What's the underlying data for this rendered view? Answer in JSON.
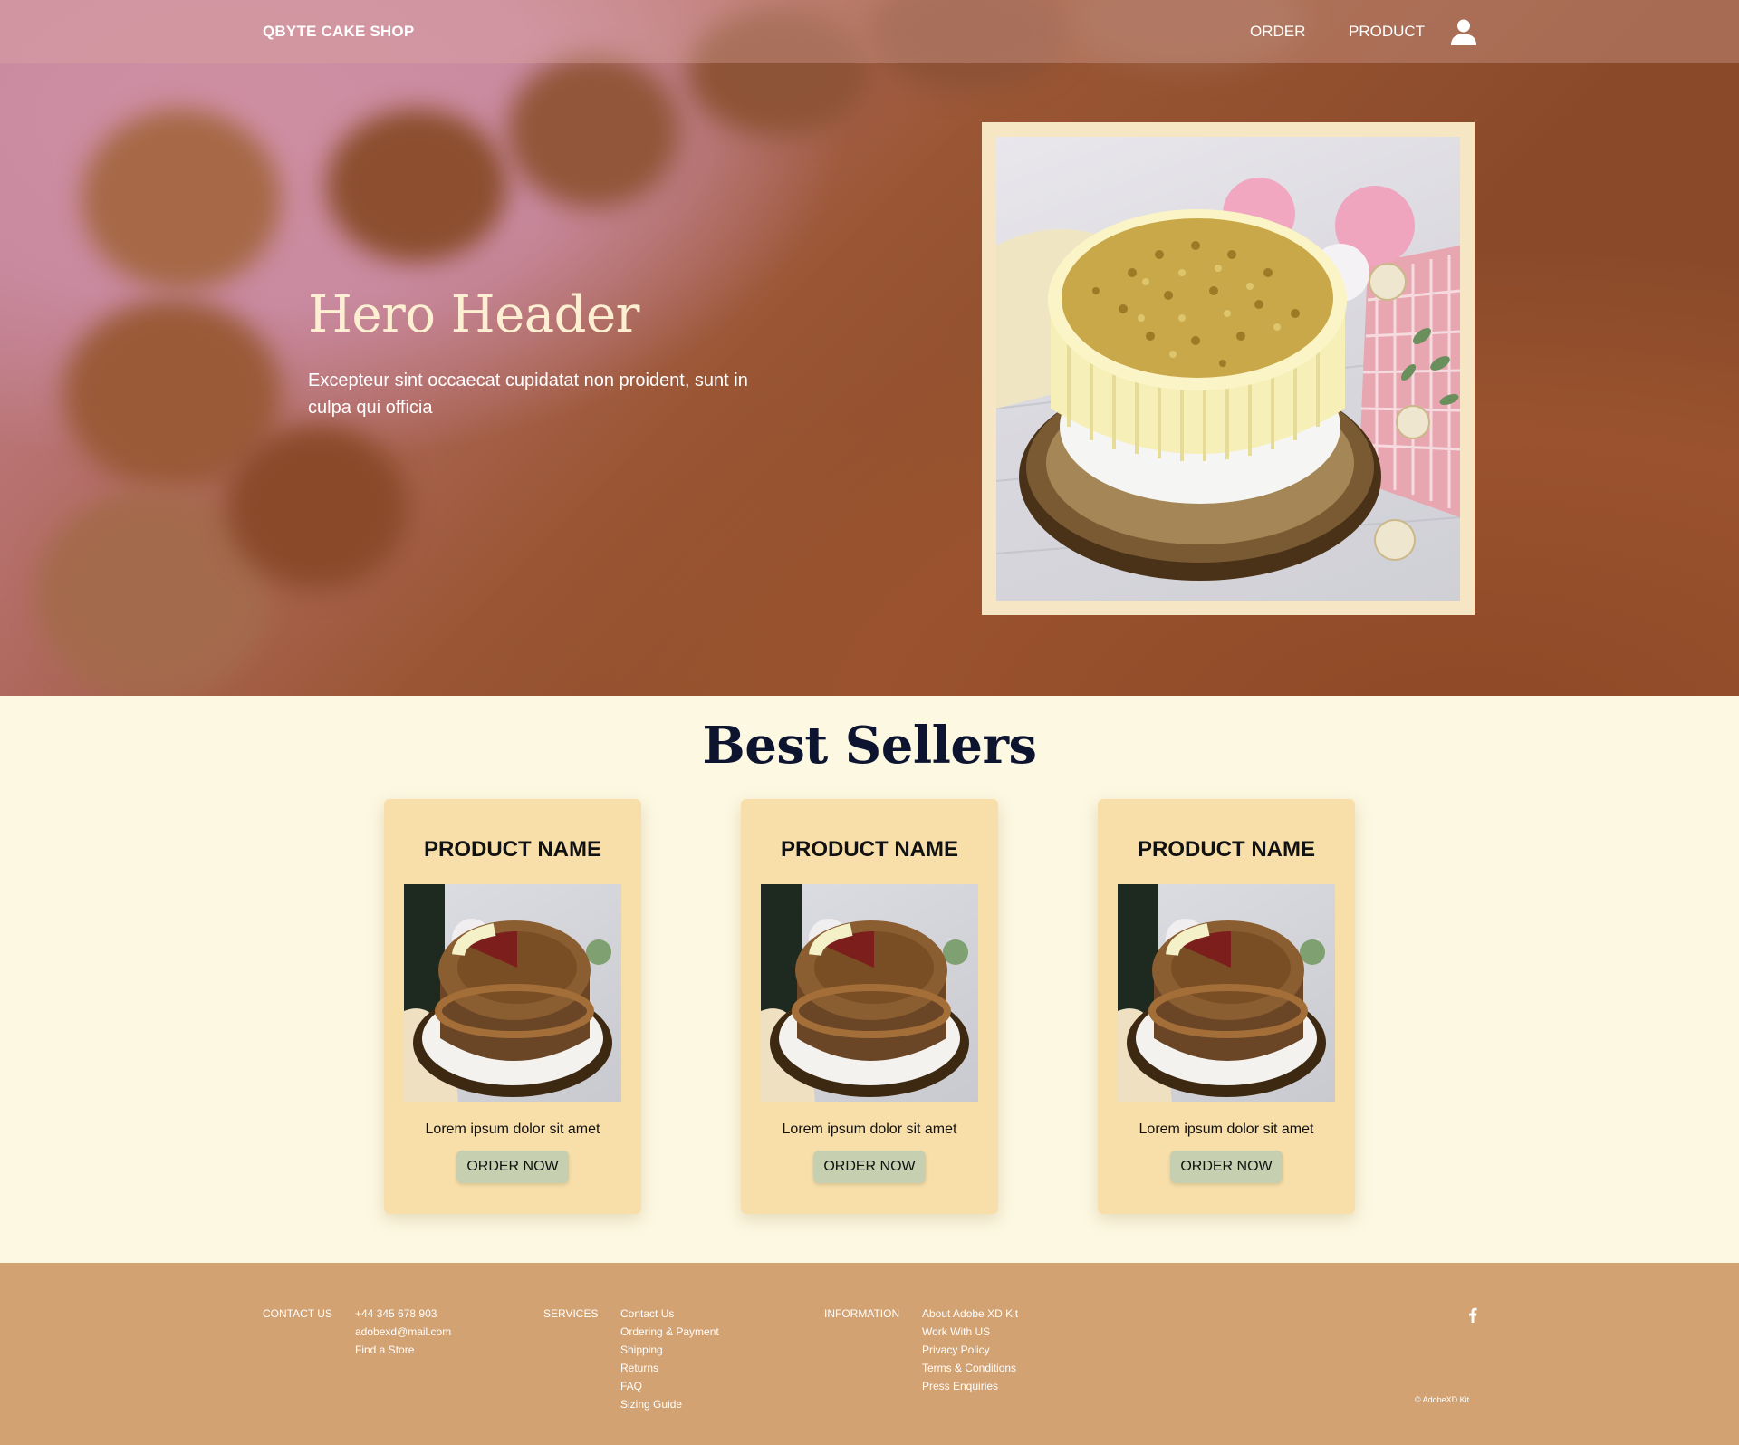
{
  "nav": {
    "brand": "QBYTE CAKE SHOP",
    "links": [
      "ORDER",
      "PRODUCT"
    ],
    "user_icon": "user-icon"
  },
  "hero": {
    "title": "Hero Header",
    "text": "Excepteur sint occaecat cupidatat non proident, sunt in culpa qui officia"
  },
  "best_sellers": {
    "title": "Best Sellers",
    "products": [
      {
        "name": "PRODUCT NAME",
        "description": "Lorem ipsum dolor sit amet",
        "button": "ORDER NOW"
      },
      {
        "name": "PRODUCT NAME",
        "description": "Lorem ipsum dolor sit amet",
        "button": "ORDER NOW"
      },
      {
        "name": "PRODUCT NAME",
        "description": "Lorem ipsum dolor sit amet",
        "button": "ORDER NOW"
      }
    ]
  },
  "footer": {
    "contact": {
      "heading": "CONTACT US",
      "items": [
        "+44 345 678 903",
        "adobexd@mail.com",
        "Find a Store"
      ]
    },
    "services": {
      "heading": "SERVICES",
      "items": [
        "Contact Us",
        "Ordering & Payment",
        "Shipping",
        "Returns",
        "FAQ",
        "Sizing Guide"
      ]
    },
    "information": {
      "heading": "INFORMATION",
      "items": [
        "About Adobe XD Kit",
        "Work With US",
        "Privacy Policy",
        "Terms & Conditions",
        "Press Enquiries"
      ]
    },
    "social_icon": "facebook-icon",
    "copyright": "© AdobeXD Kit"
  },
  "colors": {
    "page_bg": "#fdf8e2",
    "card_bg": "#f8dfa9",
    "button_bg": "#c6cfb0",
    "footer_bg": "#d2a272",
    "hero_frame": "#f7e6c4",
    "heading_dark": "#0d1430"
  }
}
